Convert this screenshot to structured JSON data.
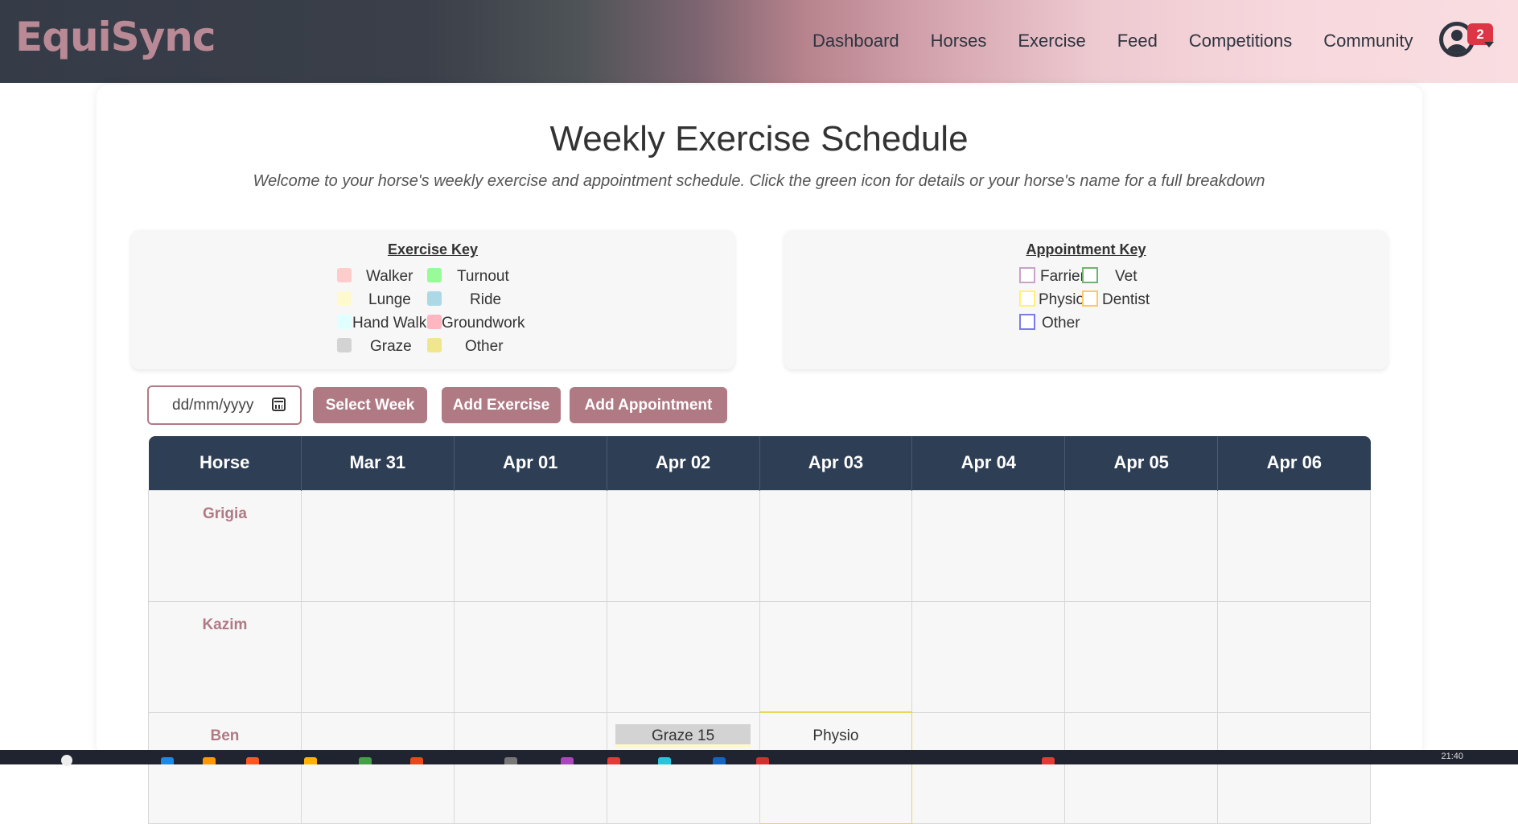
{
  "app": {
    "logo": "EquiSync"
  },
  "nav": {
    "items": [
      "Dashboard",
      "Horses",
      "Exercise",
      "Feed",
      "Competitions",
      "Community"
    ],
    "notification_count": "2"
  },
  "page": {
    "title": "Weekly Exercise Schedule",
    "subtitle": "Welcome to your horse's weekly exercise and appointment schedule. Click the green icon for details or your horse's name for a full breakdown"
  },
  "exercise_key": {
    "heading": "Exercise Key",
    "items": [
      {
        "label": "Walker",
        "color": "#ffcccc"
      },
      {
        "label": "Turnout",
        "color": "#98fb98"
      },
      {
        "label": "Lunge",
        "color": "#fffacd"
      },
      {
        "label": "Ride",
        "color": "#add8e6"
      },
      {
        "label": "Hand Walk",
        "color": "#e0ffff"
      },
      {
        "label": "Groundwork",
        "color": "#ffb6c1"
      },
      {
        "label": "Graze",
        "color": "#d3d3d3"
      },
      {
        "label": "Other",
        "color": "#f0e68c"
      }
    ]
  },
  "appointment_key": {
    "heading": "Appointment Key",
    "items": [
      {
        "label": "Farrier",
        "color": "#c8a2c8"
      },
      {
        "label": "Vet",
        "color": "#6fb36f"
      },
      {
        "label": "Physio",
        "color": "#fff176"
      },
      {
        "label": "Dentist",
        "color": "#ffc866"
      },
      {
        "label": "Other",
        "color": "#7b7be8"
      }
    ]
  },
  "controls": {
    "date_placeholder": "dd/mm/yyyy",
    "select_week": "Select Week",
    "add_exercise": "Add Exercise",
    "add_appointment": "Add Appointment"
  },
  "schedule": {
    "columns": [
      "Horse",
      "Mar 31",
      "Apr 01",
      "Apr 02",
      "Apr 03",
      "Apr 04",
      "Apr 05",
      "Apr 06"
    ],
    "rows": [
      {
        "horse": "Grigia"
      },
      {
        "horse": "Kazim"
      },
      {
        "horse": "Ben",
        "apr02_exercise": "Graze 15",
        "apr03_appointment": "Physio"
      }
    ]
  },
  "taskbar": {
    "time": "21:40"
  }
}
